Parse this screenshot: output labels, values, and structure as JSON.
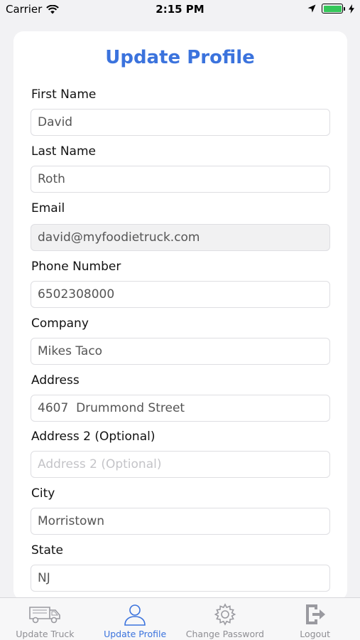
{
  "status_bar": {
    "carrier": "Carrier",
    "time": "2:15 PM"
  },
  "header": {
    "title": "Update Profile"
  },
  "form": {
    "fields": [
      {
        "label": "First Name",
        "value": "David",
        "placeholder": "First Name",
        "readonly": false
      },
      {
        "label": "Last Name",
        "value": "Roth",
        "placeholder": "Last Name",
        "readonly": false
      },
      {
        "label": "Email",
        "value": "david@myfoodietruck.com",
        "placeholder": "Email",
        "readonly": true
      },
      {
        "label": "Phone Number",
        "value": "6502308000",
        "placeholder": "Phone Number",
        "readonly": false
      },
      {
        "label": "Company",
        "value": "Mikes Taco",
        "placeholder": "Company",
        "readonly": false
      },
      {
        "label": "Address",
        "value": "4607  Drummond Street",
        "placeholder": "Address",
        "readonly": false
      },
      {
        "label": "Address 2 (Optional)",
        "value": "",
        "placeholder": "Address 2 (Optional)",
        "readonly": false
      },
      {
        "label": "City",
        "value": "Morristown",
        "placeholder": "City",
        "readonly": false
      },
      {
        "label": "State",
        "value": "NJ",
        "placeholder": "State",
        "readonly": false
      }
    ]
  },
  "tab_bar": {
    "tabs": [
      {
        "label": "Update Truck",
        "icon": "truck-icon",
        "active": false
      },
      {
        "label": "Update Profile",
        "icon": "user-icon",
        "active": true
      },
      {
        "label": "Change Password",
        "icon": "gear-icon",
        "active": false
      },
      {
        "label": "Logout",
        "icon": "logout-icon",
        "active": false
      }
    ]
  },
  "colors": {
    "accent": "#3b73dd",
    "inactive_tab": "#8e8e93",
    "battery": "#34c759"
  }
}
